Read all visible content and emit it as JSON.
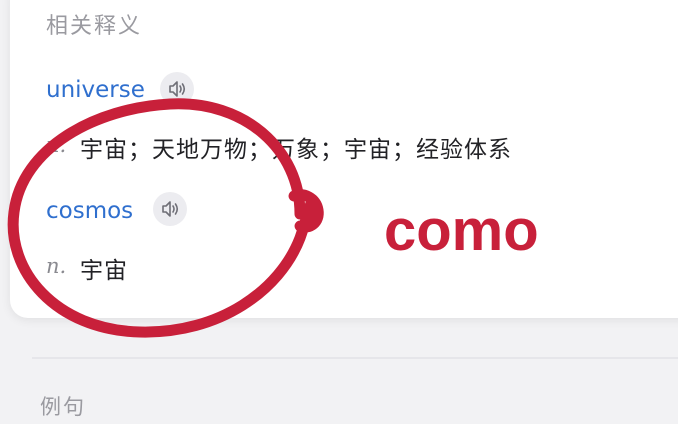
{
  "related_section": {
    "heading": "相关释义",
    "entries": [
      {
        "word": "universe",
        "pos": "n.",
        "meaning": "宇宙；天地万物；万象；宇宙；经验体系"
      },
      {
        "word": "cosmos",
        "pos": "n.",
        "meaning": "宇宙"
      }
    ]
  },
  "overlay": {
    "text": "como",
    "color": "#c8203a"
  },
  "examples_section": {
    "heading": "例句"
  },
  "colors": {
    "link_blue": "#2f6fce",
    "muted_gray": "#9a9aa0",
    "annotation_red": "#c8203a"
  },
  "icons": {
    "pronounce": "speaker-icon"
  }
}
